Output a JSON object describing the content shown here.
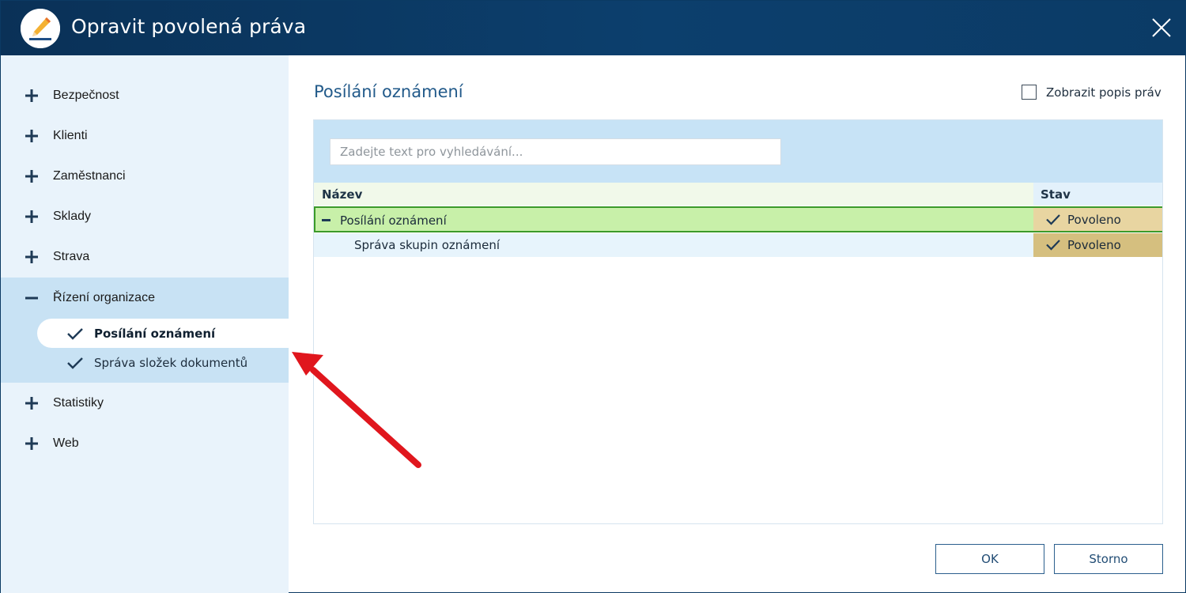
{
  "window": {
    "title": "Opravit povolená práva"
  },
  "sidebar": {
    "items": [
      {
        "label": "Bezpečnost",
        "expanded": false
      },
      {
        "label": "Klienti",
        "expanded": false
      },
      {
        "label": "Zaměstnanci",
        "expanded": false
      },
      {
        "label": "Sklady",
        "expanded": false
      },
      {
        "label": "Strava",
        "expanded": false
      },
      {
        "label": "Řízení organizace",
        "expanded": true,
        "children": [
          {
            "label": "Posílání oznámení",
            "active": true
          },
          {
            "label": "Správa složek dokumentů",
            "active": false
          }
        ]
      },
      {
        "label": "Statistiky",
        "expanded": false
      },
      {
        "label": "Web",
        "expanded": false
      }
    ]
  },
  "main": {
    "section_title": "Posílání oznámení",
    "show_description": {
      "label": "Zobrazit popis práv",
      "checked": false
    },
    "search": {
      "placeholder": "Zadejte text pro vyhledávání...",
      "value": ""
    },
    "grid": {
      "columns": [
        "Název",
        "Stav"
      ],
      "rows": [
        {
          "name": "Posílání oznámení",
          "state": "Povoleno",
          "level": 0,
          "expanded": true,
          "selected": true
        },
        {
          "name": "Správa skupin oznámení",
          "state": "Povoleno",
          "level": 1,
          "selected": false
        }
      ]
    }
  },
  "buttons": {
    "ok": "OK",
    "cancel": "Storno"
  },
  "colors": {
    "titlebar": "#0c3f6d",
    "sidebar_bg": "#e9f3fb",
    "sidebar_group_bg": "#c8e2f4",
    "selected_row": "#c8f0a9",
    "state_cell": "#e8d5a1",
    "annotation_arrow": "#e0161d"
  }
}
